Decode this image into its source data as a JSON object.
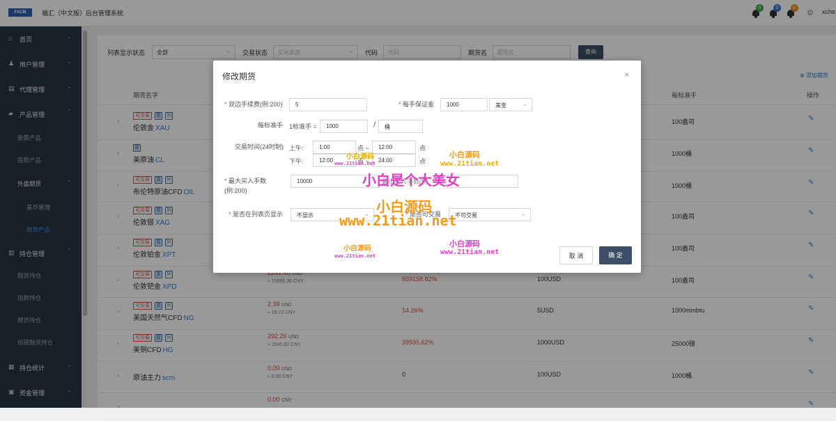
{
  "header": {
    "logo_text": "FXCM",
    "title": "福汇（中文版）后台管理系统",
    "badges": [
      "0",
      "0",
      "0"
    ],
    "user": "xche"
  },
  "sidebar": {
    "items": [
      {
        "icon": "⌂",
        "label": "首页"
      },
      {
        "icon": "♟",
        "label": "用户管理"
      },
      {
        "icon": "▤",
        "label": "代理管理"
      },
      {
        "icon": "▰",
        "label": "产品管理"
      },
      {
        "icon": "▥",
        "label": "持仓管理"
      },
      {
        "icon": "▦",
        "label": "持仓统计"
      },
      {
        "icon": "▣",
        "label": "资金管理"
      }
    ],
    "product_sub": [
      "股票产品",
      "指数产品",
      "外盘期货",
      "基币管理",
      "期货产品"
    ],
    "position_sub": [
      "融资持仓",
      "指数持仓",
      "期货持仓",
      "创建融资持仓"
    ]
  },
  "filters": {
    "display_label": "列表显示状态",
    "display_value": "全部",
    "trade_label": "交易状态",
    "trade_placeholder": "交易状态",
    "code_label": "代码",
    "code_placeholder": "代码",
    "name_label": "期货名",
    "name_placeholder": "期货名",
    "query": "查询"
  },
  "add_link": "⊕ 添加期货",
  "table": {
    "headers": [
      "期货名字",
      "每标准手",
      "操作"
    ],
    "rows": [
      {
        "tags": [
          "可交易",
          "置",
          "列"
        ],
        "name": "伦敦金",
        "code": "XAU",
        "std": "100盎司"
      },
      {
        "tags": [
          "置"
        ],
        "name": "美原油",
        "code": "CL",
        "std": "1000桶"
      },
      {
        "tags": [
          "可交易",
          "置",
          "列"
        ],
        "name": "布伦特原油CFD",
        "code": "OIL",
        "std": "1000桶"
      },
      {
        "tags": [
          "可交易",
          "置",
          "列"
        ],
        "name": "伦敦银",
        "code": "XAG",
        "std": "100盎司"
      },
      {
        "tags": [
          "可交易",
          "置",
          "列"
        ],
        "name": "伦敦铂金",
        "code": "XPT",
        "std": "100盎司"
      },
      {
        "tags": [
          "可交易",
          "置",
          "列"
        ],
        "name": "伦敦钯金",
        "code": "XPD",
        "price": "2241.46",
        "unit": "USD",
        "cny": "≈ 15690.36 CNY",
        "change": "659158.82%",
        "margin": "100USD",
        "std": "100盎司"
      },
      {
        "tags": [
          "可交易",
          "置",
          "列"
        ],
        "name": "美国天然气CFD",
        "code": "NG",
        "price": "2.39",
        "unit": "USD",
        "cny": "≈ 16.72 CNY",
        "change": "14.26%",
        "margin": "5USD",
        "std": "1000mmbtu"
      },
      {
        "tags": [
          "可交易",
          "置",
          "列"
        ],
        "name": "美铜CFD",
        "code": "HG",
        "price": "292.26",
        "unit": "USD",
        "cny": "≈ 2045.82 CNY",
        "change": "39935.62%",
        "margin": "1000USD",
        "std": "25000磅"
      },
      {
        "tags": [],
        "name": "原油主力",
        "code": "scm",
        "price": "0.00",
        "unit": "USD",
        "cny": "≈ 0.00 CNY",
        "change": "0",
        "margin": "100USD",
        "std": "1000桶"
      },
      {
        "tags": [],
        "name": "",
        "code": "",
        "price": "0.00",
        "unit": "CNY",
        "cny": "",
        "change": "",
        "margin": "",
        "std": ""
      }
    ]
  },
  "modal": {
    "title": "修改期货",
    "fee_label": "双边手续费(例:200)",
    "fee_value": "5",
    "margin_label": "每手保证金",
    "margin_value": "1000",
    "currency": "美金",
    "std_label": "每标准手",
    "std_prefix": "1标准手 =",
    "std_value": "1000",
    "slash": "/",
    "std_unit": "桶",
    "time_label": "交易时间(24时制)",
    "am_label": "上午:",
    "am_start": "1:00",
    "am_sep": "点 ~",
    "am_end": "12:00",
    "am_suffix": "点",
    "pm_label": "下午:",
    "pm_start": "12:00",
    "pm_sep": "点 ~",
    "pm_end": "24:00",
    "pm_suffix": "点",
    "max_label": "最大买入手数(例:200)",
    "max_value": "10000",
    "min_label": "最小买入手数(例",
    "min_value": "",
    "show_label": "是否在列表页显示",
    "show_value": "不显示",
    "tradeable_label": "是否可交易",
    "tradeable_value": "不可交易",
    "cancel": "取 消",
    "ok": "确 定"
  },
  "watermarks": {
    "small": "小白源码",
    "url": "www.21tian.net",
    "big": "小白是个大美女"
  },
  "colors": {
    "accent": "#3c4f66",
    "link": "#2f7fd1",
    "up": "#d84b3b",
    "sidebar": "#2a3542"
  }
}
